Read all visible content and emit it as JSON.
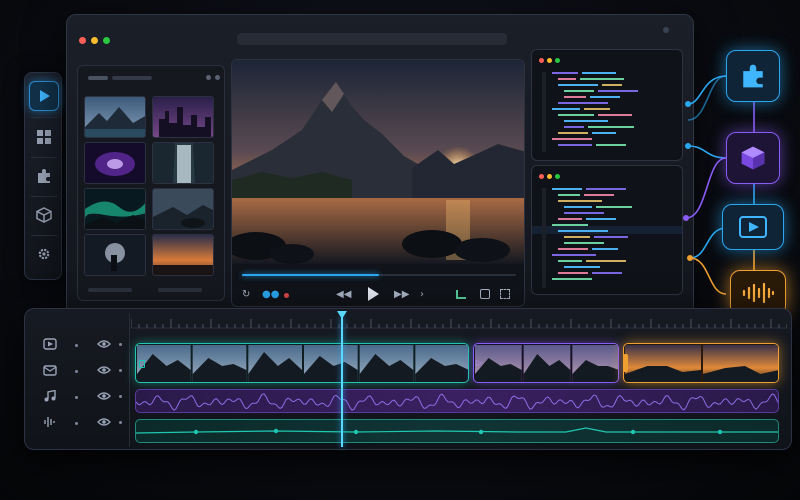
{
  "app": {
    "accent": "#2aa7f0",
    "purple": "#8a5cf6",
    "teal": "#1fc7b0",
    "orange": "#f0a030"
  },
  "rail": {
    "items": [
      {
        "icon": "play-icon",
        "active": true
      },
      {
        "icon": "grid-icon",
        "active": false
      },
      {
        "icon": "puzzle-icon",
        "active": false
      },
      {
        "icon": "cube-icon",
        "active": false
      },
      {
        "icon": "gear-icon",
        "active": false
      }
    ]
  },
  "window": {
    "controls": [
      "close",
      "minimize",
      "maximize"
    ]
  },
  "media_bin": {
    "thumbnails": [
      "mountain-lake",
      "city-night",
      "purple-nebula",
      "waterfall",
      "aurora",
      "coastal-rocks",
      "moon-silhouette",
      "sunset-shore"
    ]
  },
  "player": {
    "progress": 0.5,
    "controls": [
      "loop",
      "audio",
      "record",
      "rewind",
      "play",
      "fast-forward",
      "volume",
      "levels",
      "snapshot",
      "fullscreen"
    ]
  },
  "nodes": [
    {
      "icon": "puzzle-icon",
      "color": "#2aa7f0"
    },
    {
      "icon": "cube-icon",
      "color": "#8a5cf6"
    },
    {
      "icon": "video-icon",
      "color": "#2aa7f0"
    },
    {
      "icon": "waveform-icon",
      "color": "#f0a030"
    }
  ],
  "timeline": {
    "playhead_position": 0.32,
    "tracks": [
      {
        "icon": "video-track-icon",
        "type": "video"
      },
      {
        "icon": "mail-track-icon",
        "type": "overlay"
      },
      {
        "icon": "music-track-icon",
        "type": "audio"
      },
      {
        "icon": "waveform-track-icon",
        "type": "automation"
      }
    ]
  }
}
